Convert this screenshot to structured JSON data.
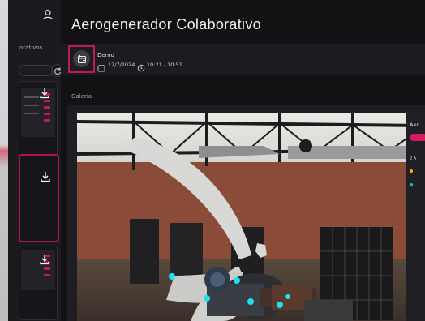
{
  "app": {
    "title": "Aerogenerador Colaborativo"
  },
  "sidebar": {
    "label": "orativos"
  },
  "event": {
    "name": "Demo",
    "date": "12/7/2024",
    "time": "10:21 - 10:51"
  },
  "gallery": {
    "label": "Galería"
  },
  "overlay": {
    "title": "Aer",
    "row1": "2 A"
  },
  "colors": {
    "accent": "#c2185b",
    "background": "#121215",
    "panel": "#1c1c20",
    "marker_yellow": "#f5b400",
    "marker_cyan": "#00c4d6"
  },
  "icons": {
    "user": "user-icon",
    "refresh": "refresh-icon",
    "download": "download-icon",
    "calendar_add": "calendar-add-icon",
    "calendar": "calendar-icon",
    "clock": "clock-icon"
  }
}
